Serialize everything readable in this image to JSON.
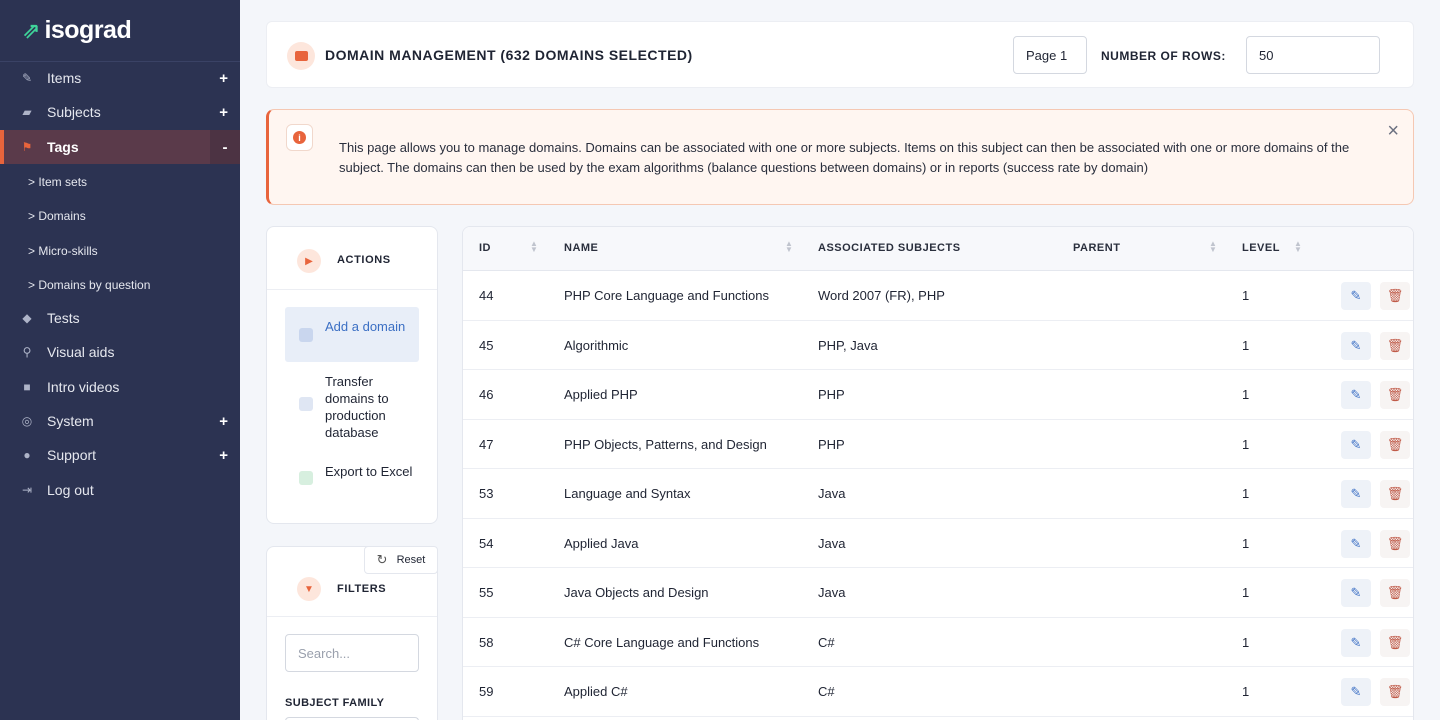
{
  "brand": {
    "logo_text": "isograd"
  },
  "sidebar": {
    "items": [
      {
        "label": "Items",
        "icon": "pencil-icon",
        "expand": "+"
      },
      {
        "label": "Subjects",
        "icon": "folder-icon",
        "expand": "+"
      },
      {
        "label": "Tags",
        "icon": "tags-icon",
        "expand": "-"
      },
      {
        "label": "Tests",
        "icon": "graduation-cap-icon",
        "expand": ""
      },
      {
        "label": "Visual aids",
        "icon": "search-icon",
        "expand": ""
      },
      {
        "label": "Intro videos",
        "icon": "video-icon",
        "expand": ""
      },
      {
        "label": "System",
        "icon": "gear-icon",
        "expand": "+"
      },
      {
        "label": "Support",
        "icon": "question-icon",
        "expand": "+"
      },
      {
        "label": "Log out",
        "icon": "logout-icon",
        "expand": ""
      }
    ],
    "sub_items": [
      "> Item sets",
      "> Domains",
      "> Micro-skills",
      "> Domains by question"
    ]
  },
  "header": {
    "title": "DOMAIN MANAGEMENT (632 DOMAINS SELECTED)",
    "page_select": "Page 1",
    "rows_label": "NUMBER OF ROWS:",
    "rows_value": "50"
  },
  "alert": {
    "text": "This page allows you to manage domains. Domains can be associated with one or more subjects. Items on this subject can then be associated with one or more domains of the subject. The domains can then be used by the exam algorithms (balance questions between domains) or in reports (success rate by domain)",
    "close": "×"
  },
  "actions": {
    "title": "ACTIONS",
    "items": [
      {
        "label": "Add a domain"
      },
      {
        "label": "Transfer domains to production database"
      },
      {
        "label": "Export to Excel"
      }
    ]
  },
  "filters": {
    "title": "FILTERS",
    "reset_label": "Reset",
    "search_placeholder": "Search...",
    "subject_family_label": "SUBJECT FAMILY"
  },
  "table": {
    "columns": [
      "ID",
      "NAME",
      "ASSOCIATED SUBJECTS",
      "PARENT",
      "LEVEL"
    ],
    "rows": [
      {
        "id": "44",
        "name": "PHP Core Language and Functions",
        "subjects": "Word 2007 (FR), PHP",
        "parent": "",
        "level": "1"
      },
      {
        "id": "45",
        "name": "Algorithmic",
        "subjects": "PHP, Java",
        "parent": "",
        "level": "1"
      },
      {
        "id": "46",
        "name": "Applied PHP",
        "subjects": "PHP",
        "parent": "",
        "level": "1"
      },
      {
        "id": "47",
        "name": "PHP Objects, Patterns, and Design",
        "subjects": "PHP",
        "parent": "",
        "level": "1"
      },
      {
        "id": "53",
        "name": "Language and Syntax",
        "subjects": "Java",
        "parent": "",
        "level": "1"
      },
      {
        "id": "54",
        "name": "Applied Java",
        "subjects": "Java",
        "parent": "",
        "level": "1"
      },
      {
        "id": "55",
        "name": "Java Objects and Design",
        "subjects": "Java",
        "parent": "",
        "level": "1"
      },
      {
        "id": "58",
        "name": "C# Core Language and Functions",
        "subjects": "C#",
        "parent": "",
        "level": "1"
      },
      {
        "id": "59",
        "name": "Applied C#",
        "subjects": "C#",
        "parent": "",
        "level": "1"
      }
    ]
  },
  "colors": {
    "accent": "#e8643c",
    "sidebar_bg": "#2c3352",
    "link": "#3b6fc4"
  }
}
